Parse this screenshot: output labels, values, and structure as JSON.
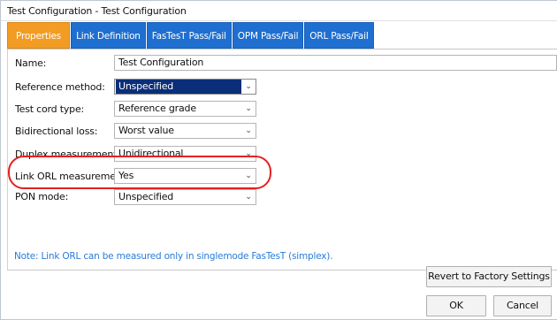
{
  "window": {
    "title": "Test Configuration - Test Configuration"
  },
  "tabs": [
    {
      "label": "Properties",
      "active": true
    },
    {
      "label": "Link Definition",
      "active": false
    },
    {
      "label": "FasTesT Pass/Fail",
      "active": false
    },
    {
      "label": "OPM Pass/Fail",
      "active": false
    },
    {
      "label": "ORL Pass/Fail",
      "active": false
    }
  ],
  "form": {
    "name": {
      "label": "Name:",
      "value": "Test Configuration"
    },
    "reference_method": {
      "label": "Reference method:",
      "value": "Unspecified"
    },
    "test_cord_type": {
      "label": "Test cord type:",
      "value": "Reference grade"
    },
    "bidirectional_loss": {
      "label": "Bidirectional loss:",
      "value": "Worst value"
    },
    "duplex_measurement": {
      "label": "Duplex measurement:",
      "value": "Unidirectional"
    },
    "link_orl_measurement": {
      "label": "Link ORL measurement:",
      "value": "Yes"
    },
    "pon_mode": {
      "label": "PON mode:",
      "value": "Unspecified"
    }
  },
  "note": "Note: Link ORL can be measured only in singlemode FasTesT (simplex).",
  "buttons": {
    "revert": "Revert to Factory Settings",
    "ok": "OK",
    "cancel": "Cancel"
  },
  "colors": {
    "tab_active": "#f29c24",
    "tab_inactive": "#1f6fd0",
    "selection": "#0b2e78",
    "annotation": "#e12222",
    "note_text": "#2a7bd6"
  },
  "icons": {
    "dropdown": "chevron-down-icon"
  }
}
